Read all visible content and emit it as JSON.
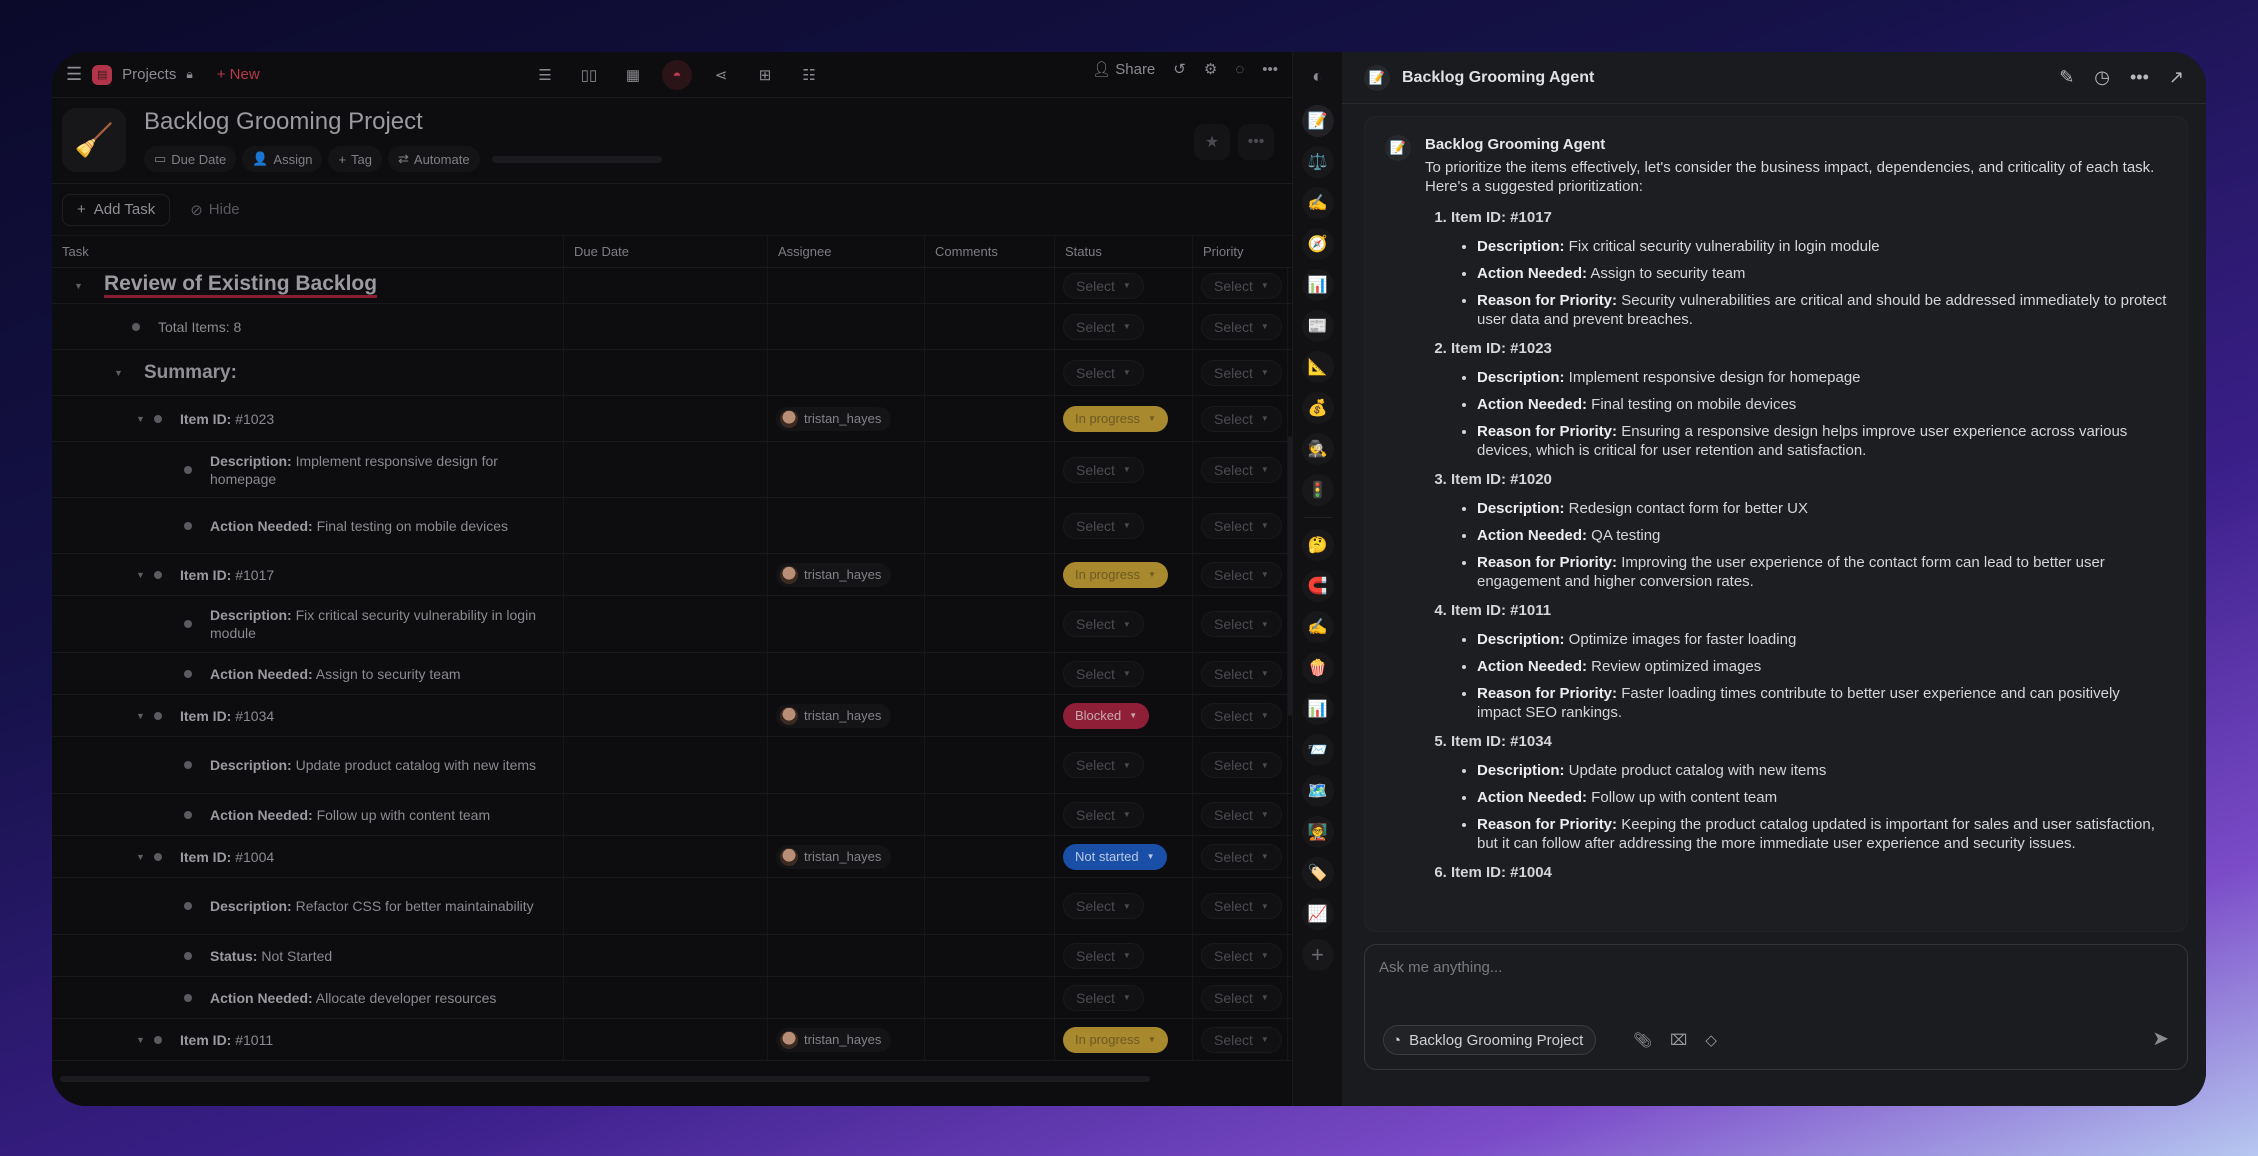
{
  "topbar": {
    "projects_label": "Projects",
    "new_label": "New",
    "share_label": "Share",
    "view_icons": [
      "list-view-icon",
      "board-view-icon",
      "calendar-view-icon",
      "table-view-icon",
      "mindmap-view-icon",
      "org-view-icon",
      "gantt-view-icon"
    ],
    "active_view": "table-view-icon"
  },
  "project": {
    "title": "Backlog Grooming Project",
    "icon": "🧹",
    "chips": [
      {
        "icon": "▭",
        "label": "Due Date"
      },
      {
        "icon": "👤",
        "label": "Assign"
      },
      {
        "icon": "+",
        "label": "Tag"
      },
      {
        "icon": "⇄",
        "label": "Automate"
      }
    ]
  },
  "toolbar": {
    "add_task_label": "Add Task",
    "hide_label": "Hide"
  },
  "table": {
    "columns": [
      "Task",
      "Due Date",
      "Assignee",
      "Comments",
      "Status",
      "Priority"
    ],
    "select_placeholder": "Select",
    "rows": [
      {
        "level": 0,
        "type": "heading",
        "caret": true,
        "bold": "",
        "text": "Review of Existing Backlog",
        "assignee": "",
        "status": "",
        "h": 36
      },
      {
        "level": 1,
        "type": "bullet",
        "caret": false,
        "bold": "",
        "text": "Total Items: 8",
        "assignee": "",
        "status": "",
        "h": 46
      },
      {
        "level": 1,
        "type": "subheading",
        "caret": true,
        "bold": "",
        "text": "Summary:",
        "assignee": "",
        "status": "",
        "h": 46
      },
      {
        "level": 2,
        "type": "item",
        "caret": true,
        "bold": "Item ID:",
        "text": " #1023",
        "assignee": "tristan_hayes",
        "status": "In progress",
        "h": 46
      },
      {
        "level": 3,
        "type": "bullet",
        "caret": false,
        "bold": "Description:",
        "text": " Implement responsive design for homepage",
        "assignee": "",
        "status": "",
        "h": 56
      },
      {
        "level": 3,
        "type": "bullet",
        "caret": false,
        "bold": "Action Needed:",
        "text": " Final testing on mobile devices",
        "assignee": "",
        "status": "",
        "h": 56
      },
      {
        "level": 2,
        "type": "item",
        "caret": true,
        "bold": "Item ID:",
        "text": " #1017",
        "assignee": "tristan_hayes",
        "status": "In progress",
        "h": 42
      },
      {
        "level": 3,
        "type": "bullet",
        "caret": false,
        "bold": "Description:",
        "text": " Fix critical security vulnerability in login module",
        "assignee": "",
        "status": "",
        "h": 57
      },
      {
        "level": 3,
        "type": "bullet",
        "caret": false,
        "bold": "Action Needed:",
        "text": " Assign to security team",
        "assignee": "",
        "status": "",
        "h": 42
      },
      {
        "level": 2,
        "type": "item",
        "caret": true,
        "bold": "Item ID:",
        "text": " #1034",
        "assignee": "tristan_hayes",
        "status": "Blocked",
        "h": 42
      },
      {
        "level": 3,
        "type": "bullet",
        "caret": false,
        "bold": "Description:",
        "text": " Update product catalog with new items",
        "assignee": "",
        "status": "",
        "h": 57
      },
      {
        "level": 3,
        "type": "bullet",
        "caret": false,
        "bold": "Action Needed:",
        "text": " Follow up with content team",
        "assignee": "",
        "status": "",
        "h": 42
      },
      {
        "level": 2,
        "type": "item",
        "caret": true,
        "bold": "Item ID:",
        "text": " #1004",
        "assignee": "tristan_hayes",
        "status": "Not started",
        "h": 42
      },
      {
        "level": 3,
        "type": "bullet",
        "caret": false,
        "bold": "Description:",
        "text": " Refactor CSS for better maintainability",
        "assignee": "",
        "status": "",
        "h": 57
      },
      {
        "level": 3,
        "type": "bullet",
        "caret": false,
        "bold": "Status:",
        "text": " Not Started",
        "assignee": "",
        "status": "",
        "h": 42
      },
      {
        "level": 3,
        "type": "bullet",
        "caret": false,
        "bold": "Action Needed:",
        "text": " Allocate developer resources",
        "assignee": "",
        "status": "",
        "h": 42
      },
      {
        "level": 2,
        "type": "item",
        "caret": true,
        "bold": "Item ID:",
        "text": " #1011",
        "assignee": "tristan_hayes",
        "status": "In progress",
        "h": 42
      }
    ],
    "status_colors": {
      "In progress": {
        "bg": "#a8892e",
        "fg": "#6e5a22"
      },
      "Blocked": {
        "bg": "#8e1f36",
        "fg": "#c7a9b0"
      },
      "Not started": {
        "bg": "#1a4fa8",
        "fg": "#b9c9e6"
      }
    }
  },
  "rail": {
    "toggle_icon": "sidebar-toggle-icon",
    "agents": [
      {
        "name": "memo",
        "glyph": "📝"
      },
      {
        "name": "scales",
        "glyph": "⚖️"
      },
      {
        "name": "writing-hand",
        "glyph": "✍️"
      },
      {
        "name": "compass",
        "glyph": "🧭"
      },
      {
        "name": "bar-chart",
        "glyph": "📊"
      },
      {
        "name": "newspaper",
        "glyph": "📰"
      },
      {
        "name": "triangle-ruler",
        "glyph": "📐"
      },
      {
        "name": "money-bag",
        "glyph": "💰"
      },
      {
        "name": "detective",
        "glyph": "🕵️"
      },
      {
        "name": "traffic-light",
        "glyph": "🚦"
      },
      {
        "name": "thinking-face",
        "glyph": "🤔"
      },
      {
        "name": "magnet",
        "glyph": "🧲"
      },
      {
        "name": "writing-hand",
        "glyph": "✍️"
      },
      {
        "name": "popcorn",
        "glyph": "🍿"
      },
      {
        "name": "bar-chart",
        "glyph": "📊"
      },
      {
        "name": "envelope",
        "glyph": "📨"
      },
      {
        "name": "world-map",
        "glyph": "🗺️"
      },
      {
        "name": "teacher",
        "glyph": "🧑‍🏫"
      },
      {
        "name": "label-tag",
        "glyph": "🏷️"
      },
      {
        "name": "chart-increase",
        "glyph": "📈"
      }
    ],
    "add_label": "+"
  },
  "chat": {
    "title": "Backlog Grooming Agent",
    "agent_icon": "📝",
    "message": {
      "sender": "Backlog Grooming Agent",
      "intro": "To prioritize the items effectively, let's consider the business impact, dependencies, and criticality of each task. Here's a suggested prioritization:",
      "items": [
        {
          "id_label": "Item ID: #1017",
          "details": [
            {
              "k": "Description:",
              "v": " Fix critical security vulnerability in login module"
            },
            {
              "k": "Action Needed:",
              "v": " Assign to security team"
            },
            {
              "k": "Reason for Priority:",
              "v": " Security vulnerabilities are critical and should be addressed immediately to protect user data and prevent breaches."
            }
          ]
        },
        {
          "id_label": "Item ID: #1023",
          "details": [
            {
              "k": "Description:",
              "v": " Implement responsive design for homepage"
            },
            {
              "k": "Action Needed:",
              "v": " Final testing on mobile devices"
            },
            {
              "k": "Reason for Priority:",
              "v": " Ensuring a responsive design helps improve user experience across various devices, which is critical for user retention and satisfaction."
            }
          ]
        },
        {
          "id_label": "Item ID: #1020",
          "details": [
            {
              "k": "Description:",
              "v": " Redesign contact form for better UX"
            },
            {
              "k": "Action Needed:",
              "v": " QA testing"
            },
            {
              "k": "Reason for Priority:",
              "v": " Improving the user experience of the contact form can lead to better user engagement and higher conversion rates."
            }
          ]
        },
        {
          "id_label": "Item ID: #1011",
          "details": [
            {
              "k": "Description:",
              "v": " Optimize images for faster loading"
            },
            {
              "k": "Action Needed:",
              "v": " Review optimized images"
            },
            {
              "k": "Reason for Priority:",
              "v": " Faster loading times contribute to better user experience and can positively impact SEO rankings."
            }
          ]
        },
        {
          "id_label": "Item ID: #1034",
          "details": [
            {
              "k": "Description:",
              "v": " Update product catalog with new items"
            },
            {
              "k": "Action Needed:",
              "v": " Follow up with content team"
            },
            {
              "k": "Reason for Priority:",
              "v": " Keeping the product catalog updated is important for sales and user satisfaction, but it can follow after addressing the more immediate user experience and security issues."
            }
          ]
        },
        {
          "id_label": "Item ID: #1004",
          "details": []
        }
      ]
    },
    "composer": {
      "placeholder": "Ask me anything...",
      "context_chip": "Backlog Grooming Project"
    }
  }
}
